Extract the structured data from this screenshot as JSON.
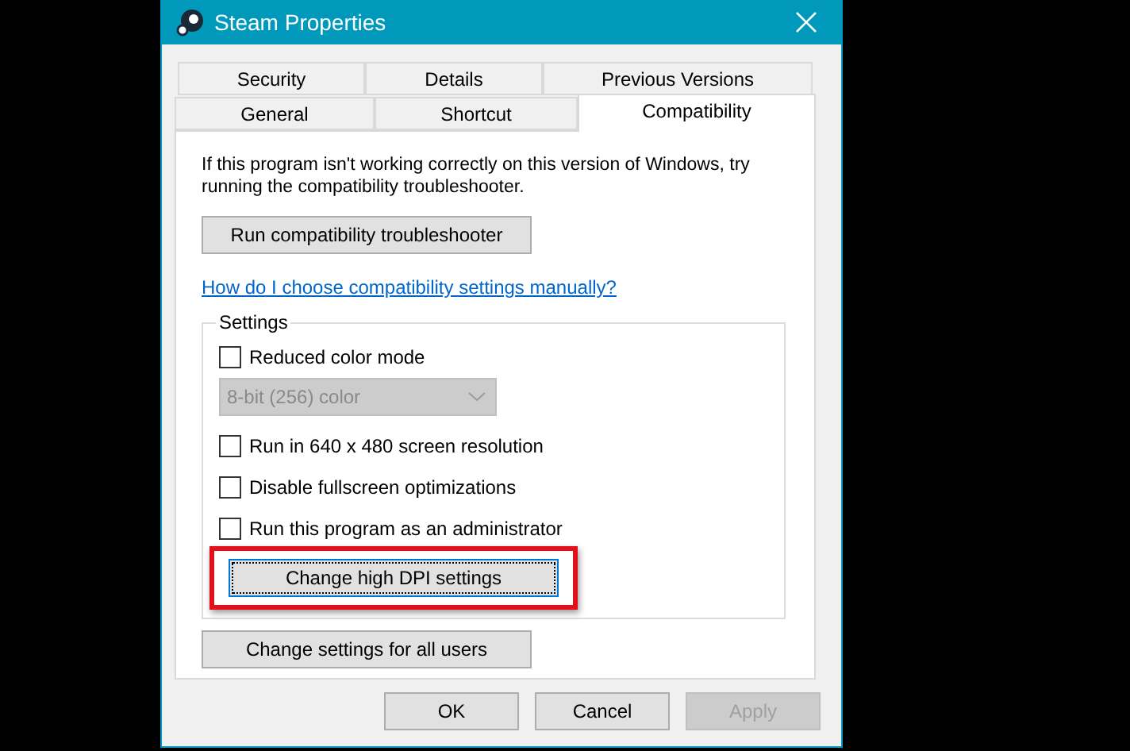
{
  "window": {
    "title": "Steam Properties"
  },
  "tab_rows": [
    [
      {
        "label": "Security",
        "selected": false
      },
      {
        "label": "Details",
        "selected": false
      },
      {
        "label": "Previous Versions",
        "selected": false
      }
    ],
    [
      {
        "label": "General",
        "selected": false
      },
      {
        "label": "Shortcut",
        "selected": false
      },
      {
        "label": "Compatibility",
        "selected": true
      }
    ]
  ],
  "intro": "If this program isn't working correctly on this version of Windows, try running the compatibility troubleshooter.",
  "troubleshooter_button": "Run compatibility troubleshooter",
  "help_link": "How do I choose compatibility settings manually?",
  "settings": {
    "legend": "Settings",
    "items": [
      {
        "kind": "checkbox",
        "label": "Reduced color mode",
        "checked": false
      },
      {
        "kind": "dropdown",
        "value": "8-bit (256) color",
        "disabled": true
      },
      {
        "kind": "checkbox",
        "label": "Run in 640 x 480 screen resolution",
        "checked": false
      },
      {
        "kind": "checkbox",
        "label": "Disable fullscreen optimizations",
        "checked": false
      },
      {
        "kind": "checkbox",
        "label": "Run this program as an administrator",
        "checked": false
      },
      {
        "kind": "button",
        "label": "Change high DPI settings",
        "focused": true,
        "highlighted": true
      }
    ]
  },
  "all_users_button": "Change settings for all users",
  "buttons": [
    {
      "label": "OK",
      "disabled": false
    },
    {
      "label": "Cancel",
      "disabled": false
    },
    {
      "label": "Apply",
      "disabled": true
    }
  ]
}
